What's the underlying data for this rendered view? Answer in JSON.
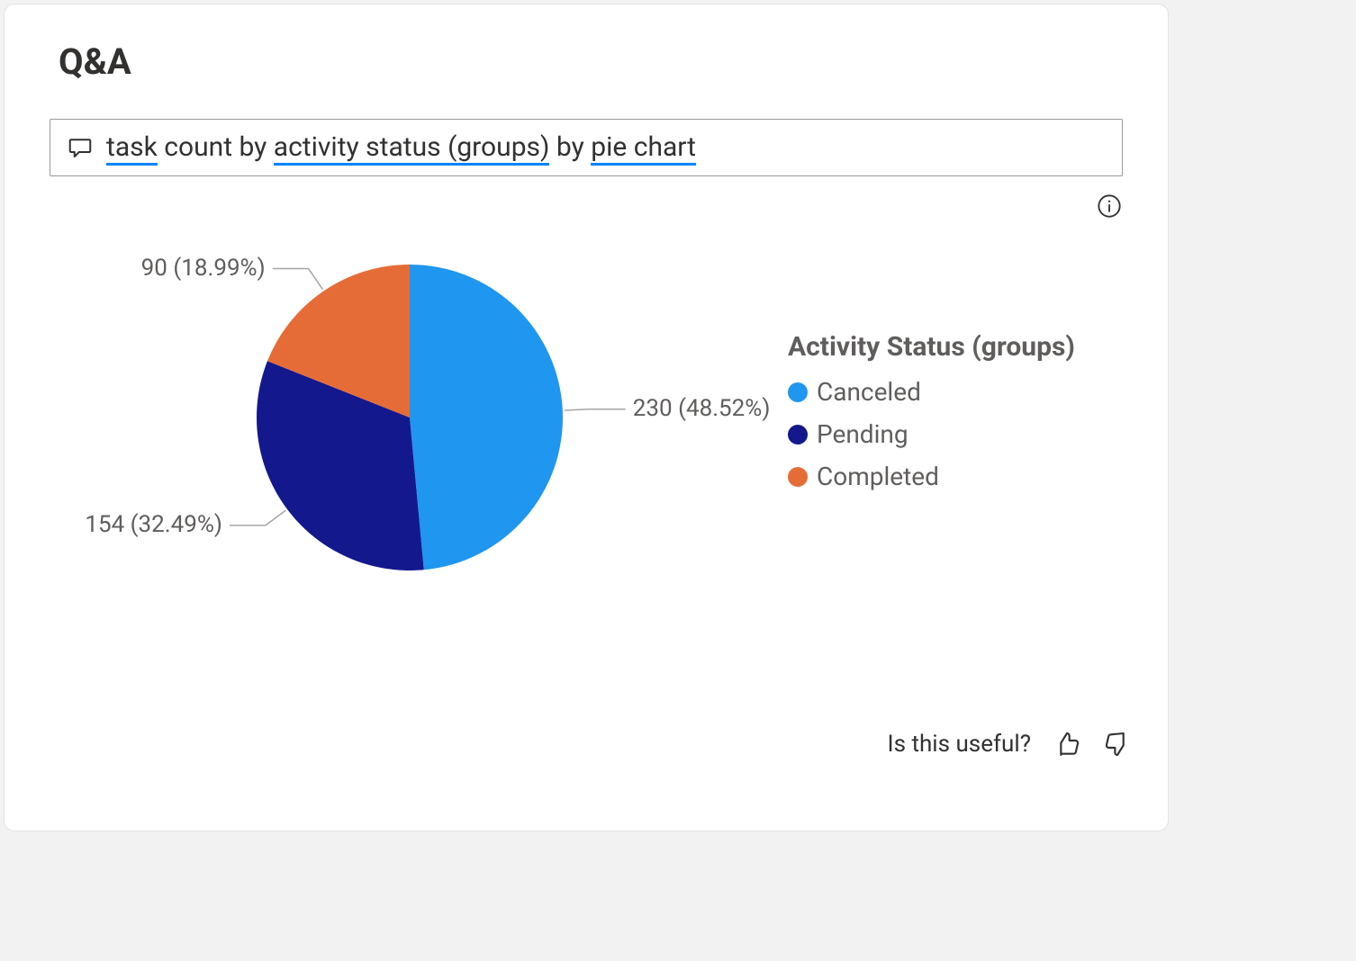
{
  "title": "Q&A",
  "query": {
    "tokens": [
      {
        "text": "task",
        "underline": true
      },
      {
        "text": " count by ",
        "underline": false
      },
      {
        "text": "activity status (groups)",
        "underline": true
      },
      {
        "text": " by ",
        "underline": false
      },
      {
        "text": "pie chart",
        "underline": true
      }
    ]
  },
  "legend_title": "Activity Status (groups)",
  "feedback_prompt": "Is this useful?",
  "chart_data": {
    "type": "pie",
    "title": "",
    "series": [
      {
        "name": "Canceled",
        "value": 230,
        "percent": 48.52,
        "color": "#1f96ef"
      },
      {
        "name": "Pending",
        "value": 154,
        "percent": 32.49,
        "color": "#14188d"
      },
      {
        "name": "Completed",
        "value": 90,
        "percent": 18.99,
        "color": "#e66c37"
      }
    ]
  }
}
